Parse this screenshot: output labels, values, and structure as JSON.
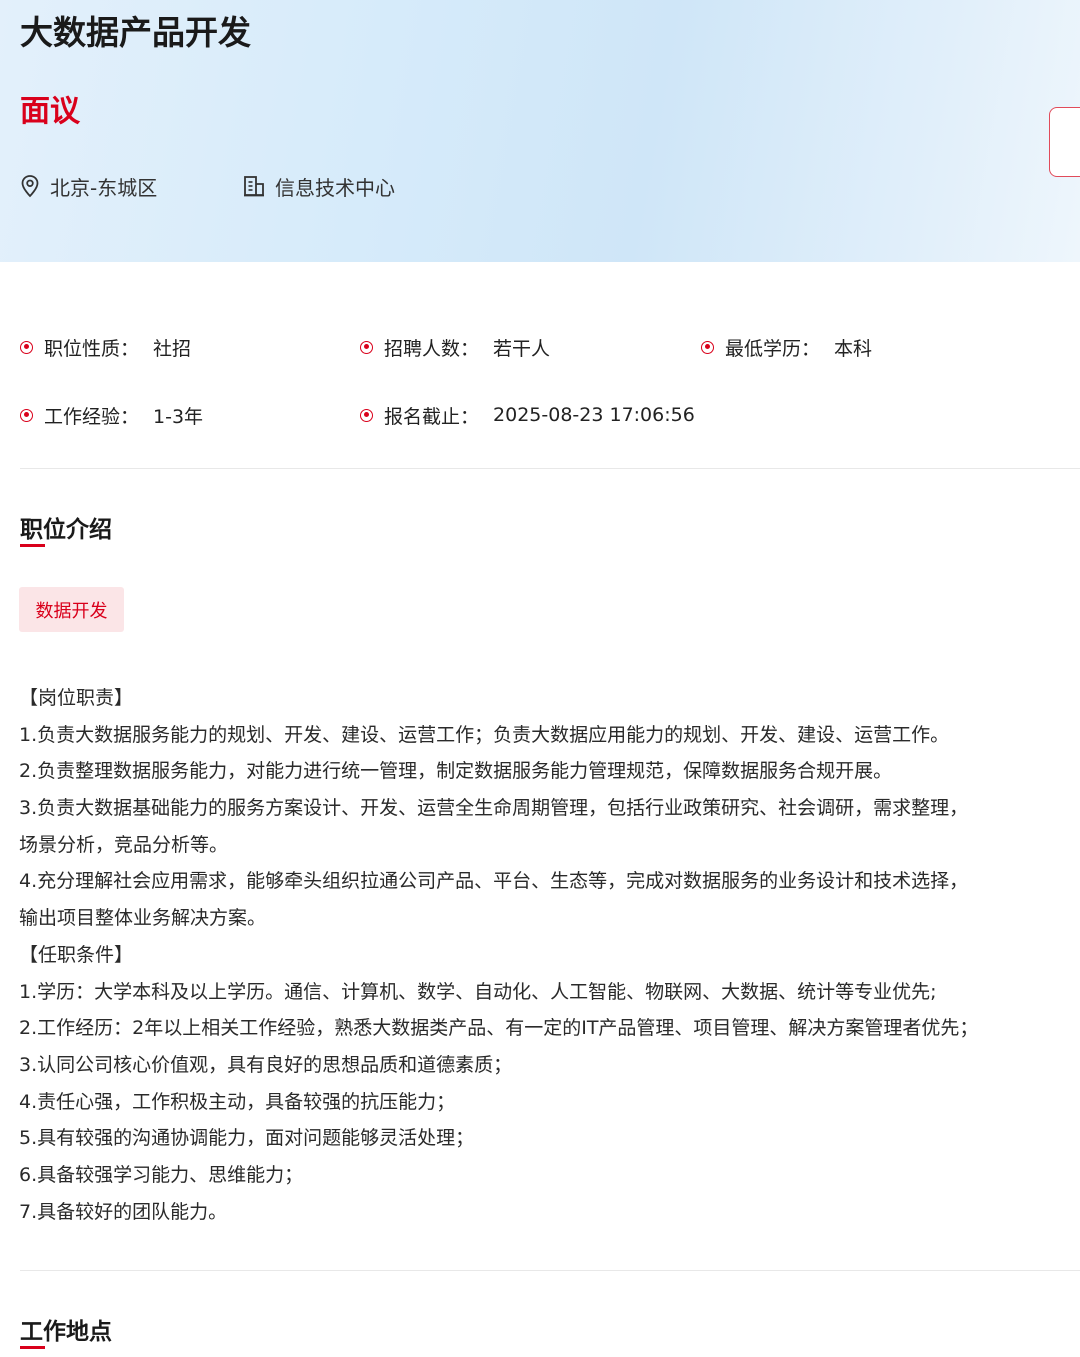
{
  "header": {
    "title": "大数据产品开发",
    "salary": "面议",
    "location": "北京-东城区",
    "department": "信息技术中心"
  },
  "attributes": [
    {
      "label": "职位性质：",
      "value": "社招"
    },
    {
      "label": "招聘人数：",
      "value": "若干人"
    },
    {
      "label": "最低学历：",
      "value": "本科"
    },
    {
      "label": "工作经验：",
      "value": "1-3年"
    },
    {
      "label": "报名截止：",
      "value": "2025-08-23 17:06:56"
    }
  ],
  "intro": {
    "title": "职位介绍",
    "tag": "数据开发",
    "lines": [
      "【岗位职责】",
      "1.负责大数据服务能力的规划、开发、建设、运营工作；负责大数据应用能力的规划、开发、建设、运营工作。",
      "2.负责整理数据服务能力，对能力进行统一管理，制定数据服务能力管理规范，保障数据服务合规开展。",
      "3.负责大数据基础能力的服务方案设计、开发、运营全生命周期管理，包括行业政策研究、社会调研，需求整理，",
      "场景分析，竞品分析等。",
      "4.充分理解社会应用需求，能够牵头组织拉通公司产品、平台、生态等，完成对数据服务的业务设计和技术选择，",
      "输出项目整体业务解决方案。",
      "【任职条件】",
      "1.学历：大学本科及以上学历。通信、计算机、数学、自动化、人工智能、物联网、大数据、统计等专业优先;",
      "2.工作经历：2年以上相关工作经验，熟悉大数据类产品、有一定的IT产品管理、项目管理、解决方案管理者优先；",
      "3.认同公司核心价值观，具有良好的思想品质和道德素质；",
      "4.责任心强，工作积极主动，具备较强的抗压能力；",
      "5.具有较强的沟通协调能力，面对问题能够灵活处理；",
      "6.具备较强学习能力、思维能力；",
      "7.具备较好的团队能力。"
    ]
  },
  "location_section": {
    "title": "工作地点"
  },
  "colors": {
    "accent": "#d9001b",
    "tag_bg": "#fbe5e7",
    "hero_bg": "#d6ebfa"
  },
  "icons": [
    "location-pin-icon",
    "building-icon",
    "radio-dot-icon"
  ]
}
